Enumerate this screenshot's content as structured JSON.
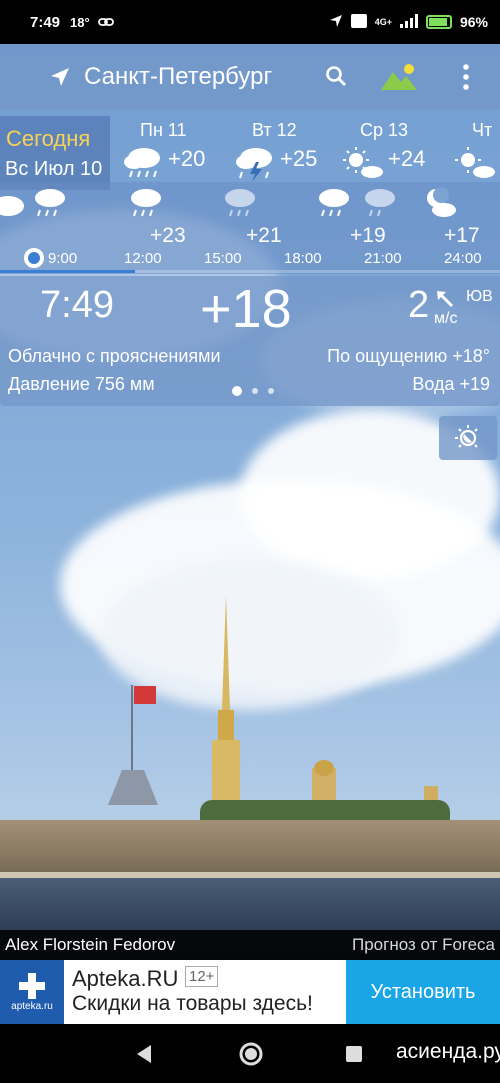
{
  "status_bar": {
    "time": "7:49",
    "temp": "18°",
    "signal": "4G+",
    "battery": "96%"
  },
  "header": {
    "city": "Санкт-Петербург"
  },
  "days": {
    "today_label": "Сегодня",
    "today_date": "Вс Июл 10",
    "items": [
      {
        "name": "Пн 11",
        "temp": "+20",
        "icon": "rain-cloud-icon"
      },
      {
        "name": "Вт 12",
        "temp": "+25",
        "icon": "thunderstorm-icon"
      },
      {
        "name": "Ср 13",
        "temp": "+24",
        "icon": "sun-cloud-icon"
      },
      {
        "name": "Чт",
        "temp": "",
        "icon": "sun-cloud-icon"
      }
    ]
  },
  "hourly": {
    "temps": [
      "+23",
      "+21",
      "+19",
      "+17"
    ],
    "times": [
      "9:00",
      "12:00",
      "15:00",
      "18:00",
      "21:00",
      "24:00"
    ],
    "progress": 0.27
  },
  "current": {
    "time": "7:49",
    "temp": "+18",
    "wind_speed": "2",
    "wind_dir": "ЮВ",
    "wind_unit": "м/с",
    "condition": "Облачно с прояснениями",
    "feels_like": "По ощущению +18°",
    "pressure": "Давление 756 мм",
    "water": "Вода +19"
  },
  "credits": {
    "photo_author": "Alex Florstein Fedorov",
    "provider": "Прогноз от Foreca"
  },
  "ad": {
    "logo_text": "apteka.ru",
    "title": "Apteka.RU",
    "age": "12+",
    "subtitle": "Скидки на товары здесь!",
    "button": "Установить"
  },
  "watermark": "асиенда.ру",
  "colors": {
    "today_label": "#f6d257",
    "ad_button": "#1aa6e6",
    "ad_logo": "#1f5cae",
    "battery": "#7ee05a"
  }
}
